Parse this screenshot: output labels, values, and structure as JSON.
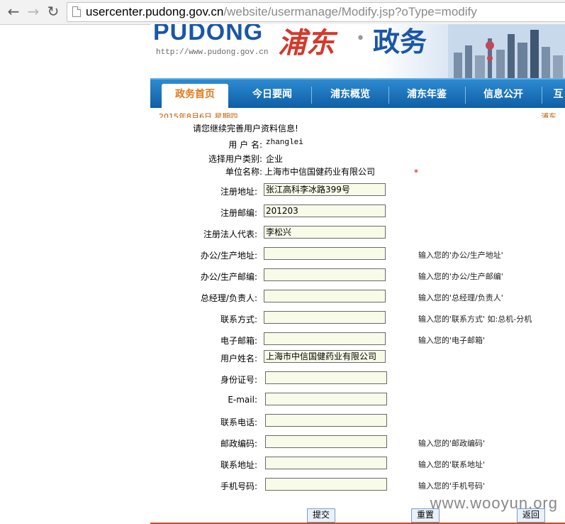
{
  "browser": {
    "url_host": "usercenter.pudong.gov.cn",
    "url_path": "/website/usermanage/Modify.jsp?oType=modify"
  },
  "header": {
    "logo": "PUDONG",
    "site_url": "http://www.pudong.gov.cn",
    "calligraphy": "浦东",
    "dot": "•",
    "zhengwu": "政务"
  },
  "nav": {
    "tabs": [
      "政务首页",
      "今日要闻",
      "浦东概览",
      "浦东年鉴",
      "信息公开",
      "互"
    ]
  },
  "subbar": {
    "date": "2015年8月6日 星期四",
    "right": "浦东"
  },
  "form": {
    "notice": "请您继续完善用户资料信息!",
    "username_label": "用 户 名:",
    "username_value": "zhanglei",
    "usertype_label": "选择用户类别:",
    "usertype_value": "企业",
    "company_label": "单位名称:",
    "company_value": "上海市中信国健药业有限公司",
    "required_star": "*",
    "fields": [
      {
        "label": "注册地址:",
        "value": "张江高科李冰路399号",
        "hint": ""
      },
      {
        "label": "注册邮编:",
        "value": "201203",
        "hint": ""
      },
      {
        "label": "注册法人代表:",
        "value": "李松兴",
        "hint": ""
      },
      {
        "label": "办公/生产地址:",
        "value": "",
        "hint": "输入您的'办公/生产地址'"
      },
      {
        "label": "办公/生产邮编:",
        "value": "",
        "hint": "输入您的'办公/生产邮编'"
      },
      {
        "label": "总经理/负责人:",
        "value": "",
        "hint": "输入您的'总经理/负责人'"
      },
      {
        "label": "联系方式:",
        "value": "",
        "hint": "输入您的'联系方式' 如:总机-分机"
      },
      {
        "label": "电子邮箱:",
        "value": "",
        "hint": "输入您的'电子邮箱'"
      },
      {
        "label": "用户姓名:",
        "value": "上海市中信国健药业有限公司",
        "hint": ""
      },
      {
        "label": "身份证号:",
        "value": "",
        "hint": ""
      },
      {
        "label": "E-mail:",
        "value": "",
        "hint": ""
      },
      {
        "label": "联系电话:",
        "value": "",
        "hint": ""
      },
      {
        "label": "邮政编码:",
        "value": "",
        "hint": "输入您的'邮政编码'"
      },
      {
        "label": "联系地址:",
        "value": "",
        "hint": "输入您的'联系地址'"
      },
      {
        "label": "手机号码:",
        "value": "",
        "hint": "输入您的'手机号码'"
      }
    ],
    "submit_label": "提交",
    "reset_label": "重置",
    "back_label": "返回"
  },
  "watermark": "www.wooyun.org",
  "colors": {
    "nav_blue": "#0e5ea6",
    "active_tab_text": "#e0781a",
    "input_bg": "#f7fbe8"
  }
}
